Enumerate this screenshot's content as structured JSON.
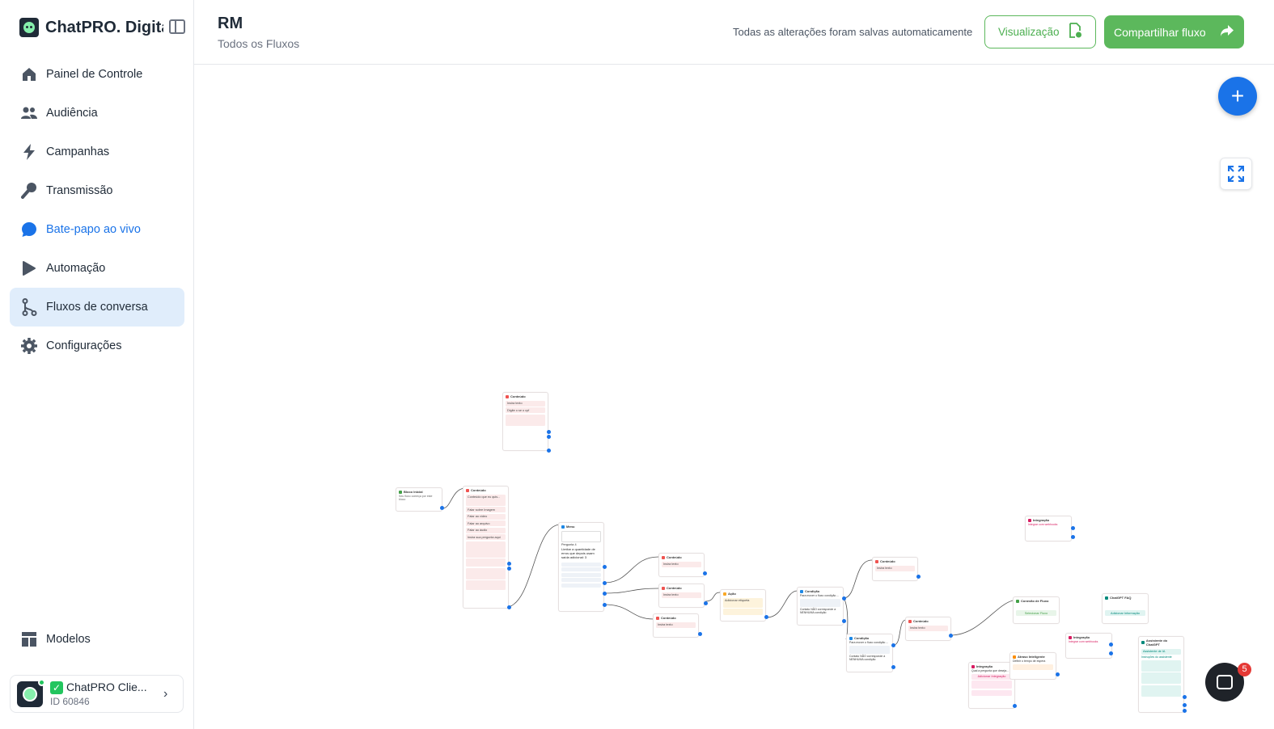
{
  "brand": {
    "name": "ChatPRO. Digital"
  },
  "sidebar": {
    "items": [
      {
        "label": "Painel de Controle",
        "icon": "home-icon"
      },
      {
        "label": "Audiência",
        "icon": "users-icon"
      },
      {
        "label": "Campanhas",
        "icon": "bolt-icon"
      },
      {
        "label": "Transmissão",
        "icon": "broadcast-icon"
      },
      {
        "label": "Bate-papo ao vivo",
        "icon": "chat-icon"
      },
      {
        "label": "Automação",
        "icon": "automation-icon"
      },
      {
        "label": "Fluxos de conversa",
        "icon": "flow-icon"
      },
      {
        "label": "Configurações",
        "icon": "gear-icon"
      }
    ],
    "bottom": {
      "label": "Modelos",
      "icon": "templates-icon"
    },
    "account": {
      "name": "ChatPRO Clie...",
      "id": "ID 60846"
    }
  },
  "header": {
    "title": "RM",
    "subtitle": "Todos os Fluxos",
    "saved_status": "Todas as alterações foram salvas automaticamente",
    "preview_label": "Visualização",
    "share_label": "Compartilhar fluxo"
  },
  "canvas": {
    "nodes": {
      "n_top_content": {
        "title": "Conteúdo",
        "b1": "Insira texto",
        "b2": "Digite o se o cpf"
      },
      "n_start": {
        "title": "Bloco Inicial",
        "b1": "Seu fluxo começa por este bloco"
      },
      "n_content_main": {
        "title": "Conteúdo",
        "b1": "Conteúdo que eu quis...",
        "b2": "Falar sobre Imagem",
        "b3": "Falar ao vídeo",
        "b4": "Falar ao arquivo",
        "b5": "Falar ao áudio",
        "b6": "Insira sua pergunta aqui"
      },
      "n_menu": {
        "title": "Menu",
        "b1": "Pergunta 4",
        "b2": "Limitar a quantidade de erros que depois usam saída adicional: 3"
      },
      "n_c1": {
        "title": "Conteúdo",
        "b1": "Insira texto"
      },
      "n_c2": {
        "title": "Conteúdo",
        "b1": "Insira texto"
      },
      "n_c3": {
        "title": "Conteúdo",
        "b1": "Insira texto"
      },
      "n_action": {
        "title": "Ação",
        "b1": "Adicionar etiqueta"
      },
      "n_cond1": {
        "title": "Condição",
        "b1": "Para mover o fluxo condição ...",
        "b2": "Contato NÃO corresponde a NENHUMA condição"
      },
      "n_c4": {
        "title": "Conteúdo",
        "b1": "Insira texto"
      },
      "n_cond2": {
        "title": "Condição",
        "b1": "Para mover o fluxo condição ...",
        "b2": "Contato NÃO corresponde a NENHUMA condição"
      },
      "n_c5": {
        "title": "Conteúdo",
        "b1": "Insira texto"
      },
      "n_integration1": {
        "title": "Integração",
        "b1": "Integrar com webhooks"
      },
      "n_integration2": {
        "title": "Integração",
        "b1": "Qual a pergunta que deseja...",
        "b2": "Adicionar Integração"
      },
      "n_integration3": {
        "title": "Integração",
        "b1": "Integrar com webhooks"
      },
      "n_smart": {
        "title": "Atraso Inteligente",
        "b1": "Definir o tempo de espera"
      },
      "n_goto": {
        "title": "Conexão de Fluxo",
        "b1": "Selecionar Fluxo"
      },
      "n_gpt_faq": {
        "title": "ChatGPT FAQ",
        "b1": "Adicionar Informação"
      },
      "n_gpt_assistant": {
        "title": "Assistente do ChatGPT",
        "b1": "Assistente de IA",
        "b2": "Instruções do assistente"
      }
    }
  },
  "chat_widget": {
    "badge": "5"
  },
  "colors": {
    "accent": "#1a73e8",
    "brand_green": "#5cb85c",
    "active_nav_bg": "#e0edfb"
  }
}
